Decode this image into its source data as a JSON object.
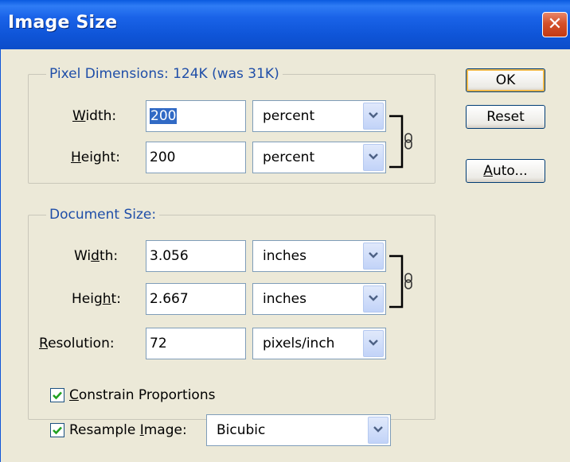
{
  "window": {
    "title": "Image Size",
    "close_glyph": "✕"
  },
  "pixel_dimensions": {
    "legend": "Pixel Dimensions:  124K (was 31K)",
    "width": {
      "label_mnemonic": "W",
      "label_rest": "idth:",
      "value": "200",
      "unit": "percent"
    },
    "height": {
      "label_mnemonic": "H",
      "label_rest": "eight:",
      "value": "200",
      "unit": "percent"
    },
    "link_icon": "chain-link-icon"
  },
  "document_size": {
    "legend": "Document Size:",
    "width": {
      "label_pre": "Wi",
      "label_mnemonic": "d",
      "label_rest": "th:",
      "value": "3.056",
      "unit": "inches"
    },
    "height": {
      "label_pre": "Heig",
      "label_mnemonic": "h",
      "label_rest": "t:",
      "value": "2.667",
      "unit": "inches"
    },
    "resolution": {
      "label_mnemonic": "R",
      "label_rest": "esolution:",
      "value": "72",
      "unit": "pixels/inch"
    },
    "link_icon": "chain-link-icon"
  },
  "options": {
    "constrain": {
      "mnemonic": "C",
      "rest": "onstrain Proportions",
      "checked": true
    },
    "resample": {
      "pre": "Resample ",
      "mnemonic": "I",
      "rest": "mage:",
      "checked": true,
      "method": "Bicubic"
    }
  },
  "buttons": {
    "ok": "OK",
    "reset": "Reset",
    "auto_mnemonic": "A",
    "auto_rest": "uto..."
  },
  "colors": {
    "titlebar": "#0f55d8",
    "legend_text": "#1f4ea8",
    "dialog_bg": "#ece9d8"
  }
}
